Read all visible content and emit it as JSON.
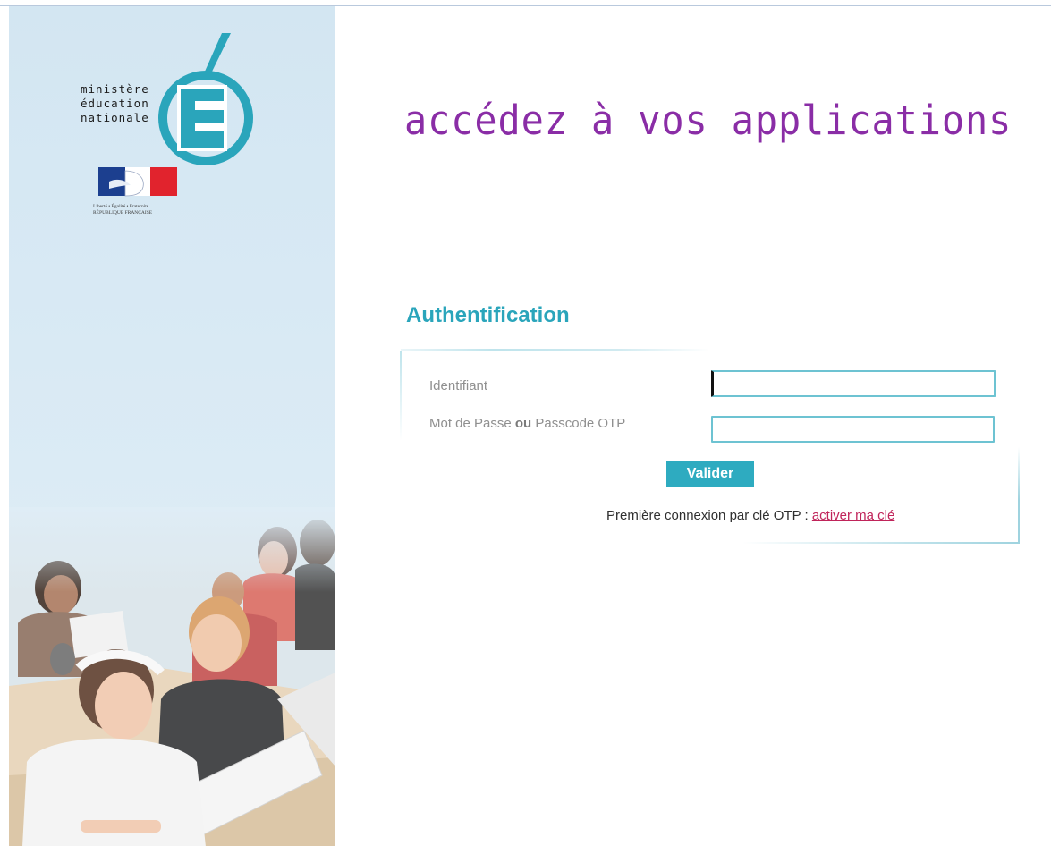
{
  "ministry_logo": {
    "lines": [
      "ministère",
      "éducation",
      "nationale"
    ],
    "letter": "É",
    "accent_color": "#2aa5bb"
  },
  "republique": {
    "motto": "Liberté • Égalité • Fraternité",
    "name": "RÉPUBLIQUE FRANÇAISE",
    "colors": [
      "#1c3f8f",
      "#ffffff",
      "#e1232d"
    ]
  },
  "header": {
    "headline": "accédez à vos applications",
    "headline_color": "#8a2da6"
  },
  "auth_form": {
    "title": "Authentification",
    "username_label": "Identifiant",
    "username_value": "",
    "password_label_part1": "Mot de Passe ",
    "password_label_or": "ou",
    "password_label_part2": " Passcode OTP",
    "password_value": "",
    "submit_label": "Valider",
    "otp_text": "Première connexion par clé OTP : ",
    "otp_link_label": "activer ma clé",
    "accent_color": "#2eabc0",
    "link_color": "#c0245a"
  }
}
